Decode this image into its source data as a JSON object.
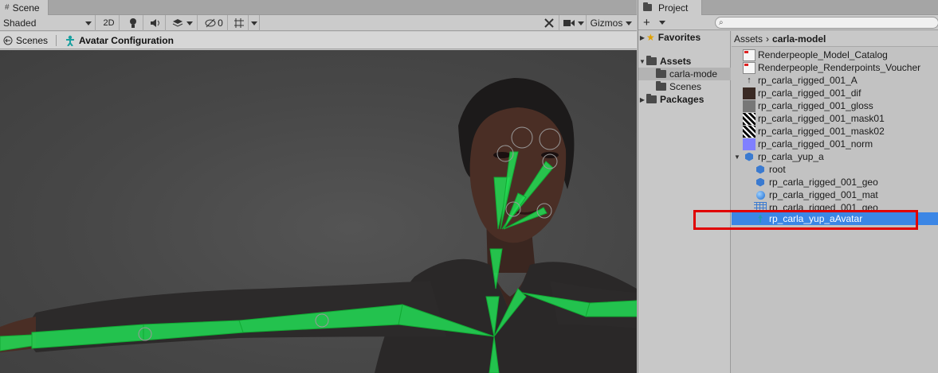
{
  "scene": {
    "tab_label": "Scene",
    "shading_mode": "Shaded",
    "toggle_2d": "2D",
    "hidden_count": "0",
    "gizmos_label": "Gizmos",
    "breadcrumb_root": "Scenes",
    "breadcrumb_current": "Avatar Configuration"
  },
  "project": {
    "tab_label": "Project",
    "search_placeholder": "",
    "tree": {
      "favorites": "Favorites",
      "assets": "Assets",
      "carla_folder": "carla-mode",
      "scenes_folder": "Scenes",
      "packages": "Packages"
    },
    "path": {
      "root": "Assets",
      "current": "carla-model"
    },
    "assets": [
      {
        "name": "Renderpeople_Model_Catalog",
        "icon": "pdf-icon"
      },
      {
        "name": "Renderpeople_Renderpoints_Voucher",
        "icon": "pdf-icon"
      },
      {
        "name": "rp_carla_rigged_001_A",
        "icon": "pin-icon"
      },
      {
        "name": "rp_carla_rigged_001_dif",
        "icon": "texture-icon"
      },
      {
        "name": "rp_carla_rigged_001_gloss",
        "icon": "texture-icon"
      },
      {
        "name": "rp_carla_rigged_001_mask01",
        "icon": "texture-icon"
      },
      {
        "name": "rp_carla_rigged_001_mask02",
        "icon": "texture-icon"
      },
      {
        "name": "rp_carla_rigged_001_norm",
        "icon": "texture-icon"
      },
      {
        "name": "rp_carla_yup_a",
        "icon": "model-icon"
      },
      {
        "name": "root",
        "icon": "cube-icon"
      },
      {
        "name": "rp_carla_rigged_001_geo",
        "icon": "cube-icon"
      },
      {
        "name": "rp_carla_rigged_001_mat",
        "icon": "material-icon"
      },
      {
        "name": "rp_carla_rigged_001_geo",
        "icon": "mesh-icon"
      },
      {
        "name": "rp_carla_yup_aAvatar",
        "icon": "avatar-icon",
        "selected": true
      }
    ]
  },
  "colors": {
    "selection": "#3b86e5",
    "highlight_box": "#e00000",
    "skeleton": "#22dd55"
  }
}
